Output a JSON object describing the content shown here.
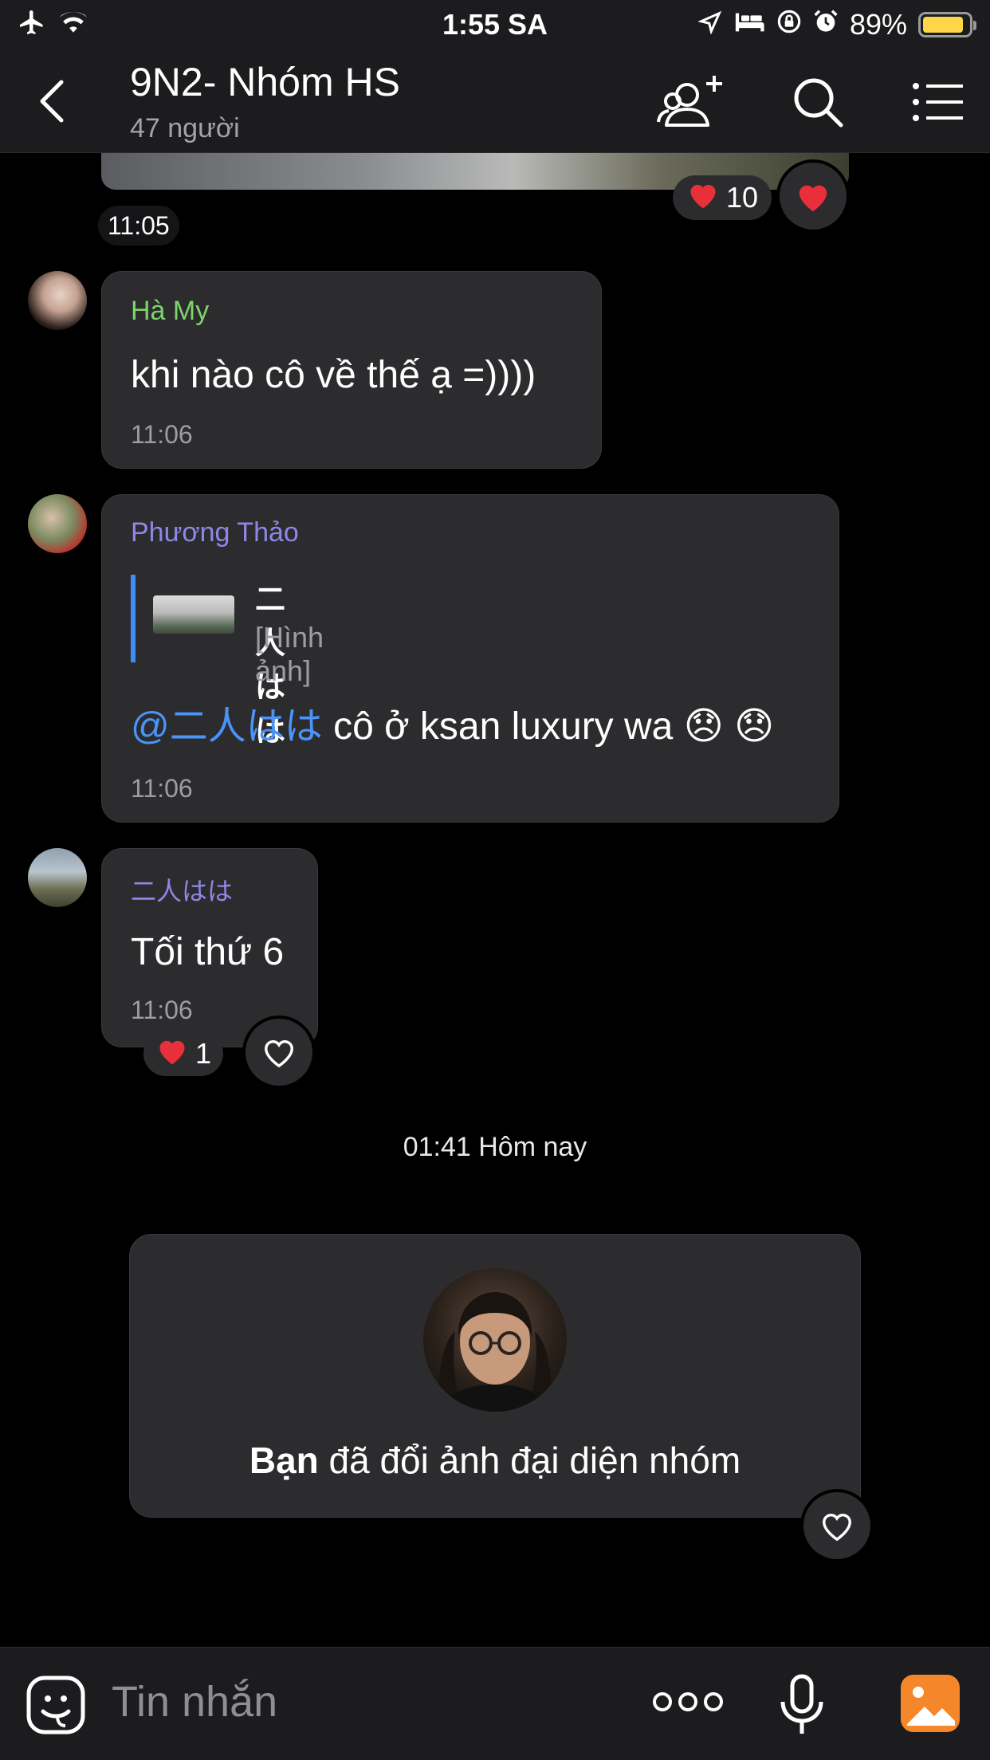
{
  "status_bar": {
    "time": "1:55 SA",
    "battery_percent": "89%",
    "battery_level": 0.89,
    "icons": [
      "airplane-icon",
      "wifi-icon",
      "location-icon",
      "bed-icon",
      "rotation-lock-icon",
      "alarm-icon",
      "battery-icon"
    ]
  },
  "header": {
    "title": "9N2- Nhóm HS",
    "subtitle": "47 người",
    "icons": [
      "back-chevron-icon",
      "add-member-icon",
      "search-icon",
      "menu-list-icon"
    ]
  },
  "messages": [
    {
      "type": "photo-tail",
      "reactions": {
        "count": "10",
        "emoji": "heart"
      },
      "time": "11:05"
    },
    {
      "sender": "Hà My",
      "sender_color": "#7ed36b",
      "text": "khi nào cô về thế ạ =))))",
      "time": "11:06"
    },
    {
      "sender": "Phương Thảo",
      "sender_color": "#8f86e8",
      "quote": {
        "name": "二人はは",
        "type": "[Hình ảnh]"
      },
      "mention": "@二人はは",
      "text": " cô ở ksan luxury wa 😞 😞",
      "time": "11:06"
    },
    {
      "sender": "二人はは",
      "sender_color": "#8f86e8",
      "text": "Tối thứ 6",
      "time": "11:06",
      "reactions": {
        "count": "1",
        "emoji": "heart"
      }
    }
  ],
  "date_separator": "01:41 Hôm nay",
  "system_card": {
    "actor": "Bạn",
    "text": " đã đổi ảnh đại diện nhóm"
  },
  "composer": {
    "placeholder": "Tin nhắn",
    "value": ""
  },
  "colors": {
    "accent": "#4a94f8",
    "heart": "#e8303a",
    "gallery": "#f5872a"
  }
}
